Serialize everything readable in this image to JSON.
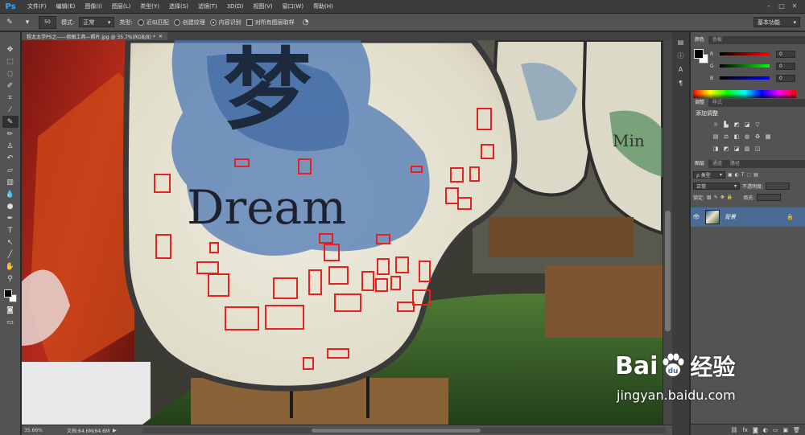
{
  "app": {
    "logo": "Ps",
    "menu": [
      "文件(F)",
      "编辑(E)",
      "图像(I)",
      "图层(L)",
      "类型(Y)",
      "选择(S)",
      "滤镜(T)",
      "3D(D)",
      "视图(V)",
      "窗口(W)",
      "帮助(H)"
    ],
    "window_controls": [
      "–",
      "□",
      "✕"
    ]
  },
  "options": {
    "brush_size": "50",
    "mode_label": "模式:",
    "mode_value": "正常",
    "type_label": "类型:",
    "type_options": [
      "近似匹配",
      "创建纹理",
      "内容识别"
    ],
    "type_selected": "内容识别",
    "sample_all_label": "对所有图层取样",
    "workspace": "基本功能"
  },
  "document": {
    "tab_title": "程太太学PS之——修图工具—照片.jpg @ 35.7%(RGB/8) *",
    "close_glyph": "✕"
  },
  "status": {
    "zoom": "35.66%",
    "doc_info": "文档:64.6M/64.6M"
  },
  "panels": {
    "color_tabs": [
      "颜色",
      "色板"
    ],
    "channels": [
      {
        "label": "R",
        "value": "0",
        "gradient": "linear-gradient(90deg,#000,#f00)"
      },
      {
        "label": "G",
        "value": "0",
        "gradient": "linear-gradient(90deg,#000,#0f0)"
      },
      {
        "label": "B",
        "value": "0",
        "gradient": "linear-gradient(90deg,#000,#00f)"
      }
    ],
    "adjust_tabs": [
      "调整",
      "样式"
    ],
    "adjust_title": "添加调整",
    "layers_tabs": [
      "图层",
      "通道",
      "路径"
    ],
    "layer_filter": "ρ 类型",
    "blend_mode": "正常",
    "opacity_label": "不透明度:",
    "lock_label": "锁定:",
    "fill_label": "填充:",
    "layer_name": "背景"
  },
  "canvas_image": {
    "sign_text_large": "Dream",
    "glyph_top": "梦",
    "side_text": "Min"
  },
  "watermark": {
    "brand": "Bai",
    "product": "经验",
    "url": "jingyan.baidu.com"
  },
  "colors": {
    "accent": "#31a8ff",
    "selection_box": "#e8201e",
    "layer_selected": "#4a6c94",
    "stone_surface": "#e6e2d2",
    "ink_blue": "#4e78b4"
  }
}
